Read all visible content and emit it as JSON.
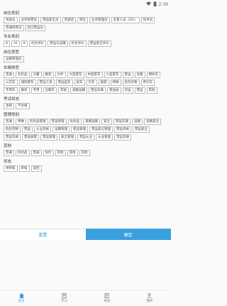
{
  "status_bar": {
    "time": "2:39"
  },
  "sections": [
    {
      "title": "岗位类别",
      "tags": [
        "驾驶员",
        "业务经营员",
        "营运安全员",
        "普通话",
        "岗位",
        "业务管理员",
        "主管人员（EIA）",
        "技术员",
        "普通经营员",
        "出口营运员"
      ]
    },
    {
      "title": "专业类别",
      "tags": [
        "B",
        "A1",
        "B",
        "综合评价",
        "营运与运输",
        "综合评价",
        "营运安全评价"
      ]
    },
    {
      "title": "岗位类型",
      "tags": [
        "运输管理员"
      ]
    },
    {
      "title": "车辆类型",
      "tags": [
        "普通",
        "危险品",
        "冷藏",
        "集装",
        "大件",
        "大型客车",
        "中型客车",
        "小型客车",
        "客运",
        "出租",
        "网约车",
        "公交车",
        "城际客车",
        "营运工具",
        "营运挂车",
        "班车",
        "包车",
        "旅游",
        "特殊",
        "危险货物",
        "牵引车",
        "专用车",
        "散装",
        "专用",
        "出租车",
        "其他",
        "道路运输",
        "营运车辆",
        "客运站",
        "货运",
        "营运",
        "其他"
      ]
    },
    {
      "title": "考试状态",
      "tags": [
        "合格",
        "不合格"
      ]
    },
    {
      "title": "管理类别",
      "tags": [
        "普通",
        "特殊",
        "危险品管理",
        "营运管理",
        "危险品",
        "道路运输",
        "安全",
        "营运车辆",
        "运输",
        "道路安全",
        "危险货物",
        "营运",
        "从业资格",
        "运输管理",
        "客运管理",
        "营运安全管理",
        "营运资格",
        "营运安全",
        "营运车辆",
        "营运质量",
        "营运管理",
        "安全管理",
        "营运从业",
        "从业管理",
        "营运车辆"
      ]
    },
    {
      "title": "其他",
      "tags": [
        "普通",
        "危险品",
        "普通",
        "危险",
        "其他",
        "其他",
        "其他"
      ]
    },
    {
      "title": "状态",
      "tags": [
        "待审核",
        "审核",
        "驳回"
      ]
    }
  ],
  "actions": {
    "cancel": "重置",
    "confirm": "确定"
  },
  "tabs": [
    {
      "label": "首页",
      "icon": "home-icon",
      "active": true
    },
    {
      "label": "学习",
      "icon": "book-icon",
      "active": false
    },
    {
      "label": "考试",
      "icon": "exam-icon",
      "active": false
    },
    {
      "label": "我的",
      "icon": "user-icon",
      "active": false
    }
  ],
  "accent_color": "#3aa0e0"
}
